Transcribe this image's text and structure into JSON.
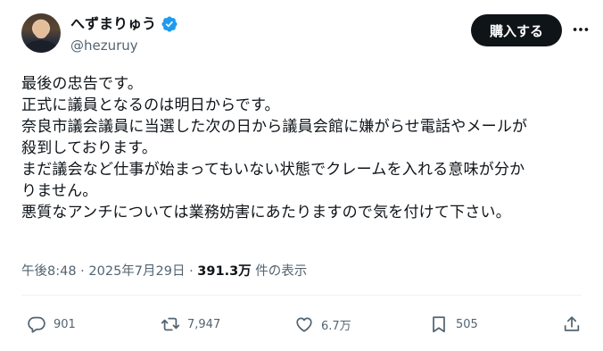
{
  "user": {
    "display_name": "へずまりゅう",
    "handle": "@hezuruy",
    "verified": true
  },
  "header": {
    "subscribe_label": "購入する"
  },
  "tweet": {
    "lines": [
      "最後の忠告です。",
      "正式に議員となるのは明日からです。",
      "奈良市議会議員に当選した次の日から議員会館に嫌がらせ電話やメールが",
      "殺到しております。",
      "まだ議会など仕事が始まってもいない状態でクレームを入れる意味が分か",
      "りません。",
      "悪質なアンチについては業務妨害にあたりますので気を付けて下さい。"
    ],
    "timestamp": "午後8:48 · 2025年7月29日 · ",
    "views_count": "391.3万",
    "views_label": " 件の表示"
  },
  "actions": {
    "replies": "901",
    "retweets": "7,947",
    "likes": "6.7万",
    "bookmarks": "505"
  },
  "colors": {
    "text": "#0f1419",
    "muted": "#536471",
    "verified_blue": "#1d9bf0",
    "button_bg": "#0f1419"
  },
  "icons": [
    "verified-badge-icon",
    "more-icon",
    "reply-icon",
    "retweet-icon",
    "like-icon",
    "bookmark-icon",
    "share-icon"
  ]
}
